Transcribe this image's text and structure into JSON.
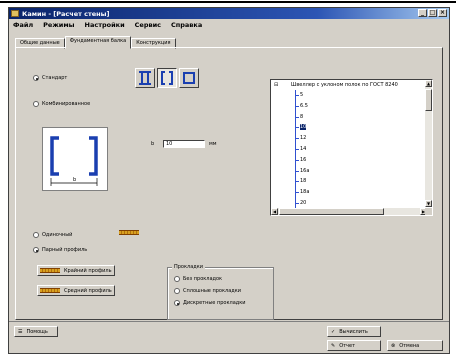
{
  "window": {
    "title": "Камин - [Расчет стены]",
    "buttons": [
      "_",
      "□",
      "×"
    ]
  },
  "menu": {
    "items": [
      "Файл",
      "Режимы",
      "Настройки",
      "Сервис",
      "Справка"
    ]
  },
  "tabs": [
    {
      "label": "Общие данные",
      "active": false
    },
    {
      "label": "Фундаментная балка",
      "active": true
    },
    {
      "label": "Конструкция",
      "active": false
    }
  ],
  "section_type": {
    "standard_label": "Стандарт",
    "composite_label": "Комбинированное",
    "selected": "standard",
    "dimension_label": "b",
    "dimension_field_label": "b",
    "dimension_value": "10",
    "dimension_unit": "мм"
  },
  "profile_tree": {
    "header": "Швеллер с уклоном полок по ГОСТ 8240",
    "items": [
      "5",
      "6.5",
      "8",
      "10",
      "12",
      "14",
      "16",
      "16а",
      "18",
      "18а",
      "20"
    ],
    "selected_index": 3
  },
  "arrangement": {
    "single_label": "Одиночный",
    "paired_label": "Парный профиль",
    "selected": "paired"
  },
  "profile_buttons": {
    "edge_label": "Крайний профиль",
    "middle_label": "Средний профиль"
  },
  "plates": {
    "legend": "Прокладки",
    "options": [
      "Без прокладок",
      "Сплошные прокладки",
      "Дискретные прокладки"
    ],
    "selected_index": 2
  },
  "bottom": {
    "help_label": "Помощь",
    "calc_label": "Вычислить",
    "report_label": "Отчет",
    "close_label": "Отмена"
  },
  "colors": {
    "titlebar": "#0a246a",
    "face": "#d4d0c8",
    "tree_line": "#3050d0",
    "profile_icon": "#d8a020"
  }
}
